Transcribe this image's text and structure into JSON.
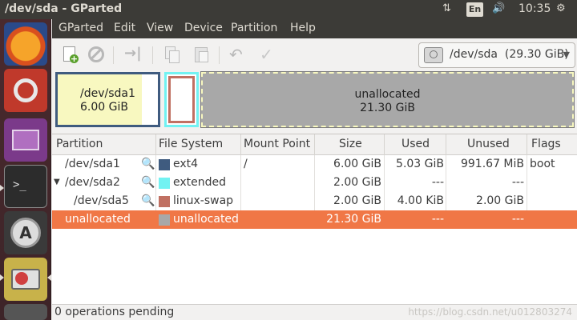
{
  "window": {
    "title": "/dev/sda - GParted"
  },
  "panel": {
    "lang": "En",
    "time": "10:35"
  },
  "menu": [
    "GParted",
    "Edit",
    "View",
    "Device",
    "Partition",
    "Help"
  ],
  "device": {
    "label": "/dev/sda",
    "size": "(29.30 GiB)"
  },
  "graph": {
    "p1_name": "/dev/sda1",
    "p1_size": "6.00 GiB",
    "unalloc_name": "unallocated",
    "unalloc_size": "21.30 GiB"
  },
  "table": {
    "headers": [
      "Partition",
      "File System",
      "Mount Point",
      "Size",
      "Used",
      "Unused",
      "Flags"
    ],
    "rows": [
      {
        "partition": "/dev/sda1",
        "fs": "ext4",
        "fs_color": "#3f5b7f",
        "mount": "/",
        "size": "6.00 GiB",
        "used": "5.03 GiB",
        "unused": "991.67 MiB",
        "flags": "boot"
      },
      {
        "partition": "/dev/sda2",
        "fs": "extended",
        "fs_color": "#72f2f2",
        "mount": "",
        "size": "2.00 GiB",
        "used": "---",
        "unused": "---",
        "flags": ""
      },
      {
        "partition": "/dev/sda5",
        "fs": "linux-swap",
        "fs_color": "#c07062",
        "mount": "",
        "size": "2.00 GiB",
        "used": "4.00 KiB",
        "unused": "2.00 GiB",
        "flags": ""
      },
      {
        "partition": "unallocated",
        "fs": "unallocated",
        "fs_color": "#a8a8a8",
        "mount": "",
        "size": "21.30 GiB",
        "used": "---",
        "unused": "---",
        "flags": ""
      }
    ]
  },
  "status": {
    "text": "0 operations pending",
    "watermark": "https://blog.csdn.net/u012803274"
  }
}
